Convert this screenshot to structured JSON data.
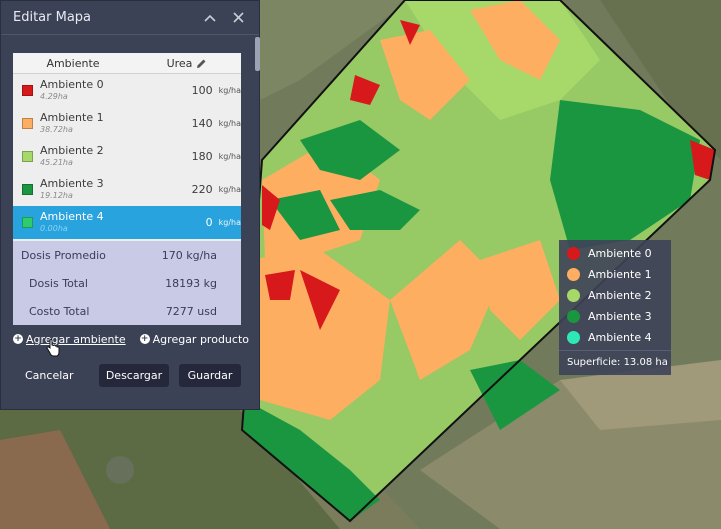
{
  "panel": {
    "title": "Editar Mapa",
    "columns": {
      "ambiente": "Ambiente",
      "urea": "Urea"
    },
    "rows": [
      {
        "name": "Ambiente 0",
        "area": "4.29ha",
        "dose": "100",
        "unit": "kg/ha",
        "color": "#d7191c"
      },
      {
        "name": "Ambiente 1",
        "area": "38.72ha",
        "dose": "140",
        "unit": "kg/ha",
        "color": "#fdae61"
      },
      {
        "name": "Ambiente 2",
        "area": "45.21ha",
        "dose": "180",
        "unit": "kg/ha",
        "color": "#a6d96a"
      },
      {
        "name": "Ambiente 3",
        "area": "19.12ha",
        "dose": "220",
        "unit": "kg/ha",
        "color": "#1a9641"
      },
      {
        "name": "Ambiente 4",
        "area": "0.00ha",
        "dose": "0",
        "unit": "kg/ha",
        "color": "#2ecc71"
      }
    ],
    "summary": {
      "dosis_promedio_label": "Dosis Promedio",
      "dosis_promedio_value": "170 kg/ha",
      "dosis_total_label": "Dosis Total",
      "dosis_total_value": "18193 kg",
      "costo_total_label": "Costo Total",
      "costo_total_value": "7277 usd"
    },
    "links": {
      "add_ambiente": "Agregar ambiente",
      "add_producto": "Agregar producto"
    },
    "buttons": {
      "cancel": "Cancelar",
      "download": "Descargar",
      "save": "Guardar"
    }
  },
  "legend": {
    "items": [
      {
        "label": "Ambiente 0",
        "color": "#d7191c"
      },
      {
        "label": "Ambiente 1",
        "color": "#fdae61"
      },
      {
        "label": "Ambiente 2",
        "color": "#a6d96a"
      },
      {
        "label": "Ambiente 3",
        "color": "#1a9641"
      },
      {
        "label": "Ambiente 4",
        "color": "#2ee8b6"
      }
    ],
    "superficie": "Superficie: 13.08 ha"
  }
}
